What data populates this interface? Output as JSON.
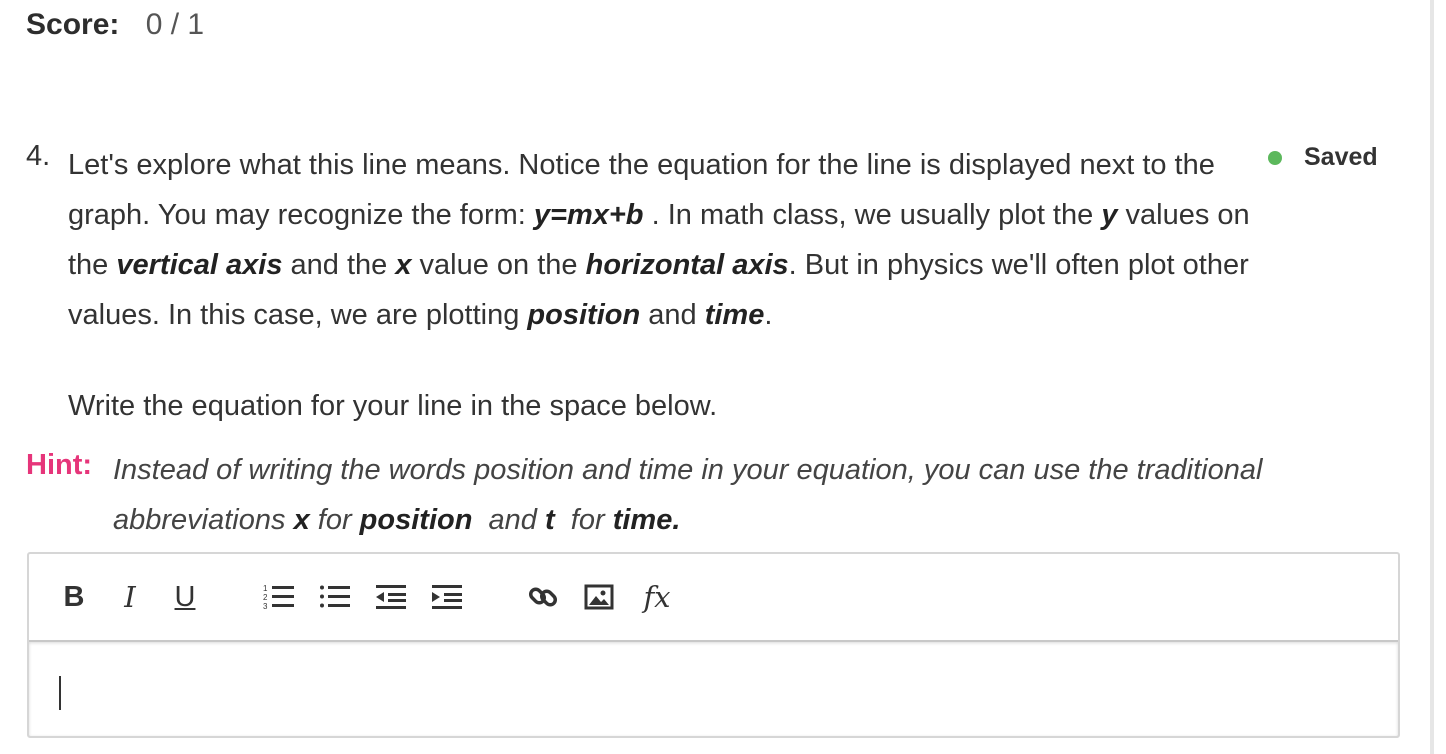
{
  "score": {
    "label": "Score:",
    "value": "0 / 1"
  },
  "question": {
    "number": "4.",
    "para": {
      "t1": "Let's explore what this line means. Notice the equation for the line is displayed next to the graph. You may recognize the form: ",
      "b1": "y=mx+b",
      "t2": " . In math class, we usually plot the ",
      "b2": "y",
      "t3": " values on the ",
      "b3": "vertical axis",
      "t4": " and the ",
      "b4": "x",
      "t5": " value on the ",
      "b5": "horizontal axis",
      "t6": ". But in physics we'll often plot other values. In this case, we are plotting ",
      "b6": "position",
      "t7": " and ",
      "b7": "time",
      "t8": "."
    },
    "write_prompt": "Write the equation for your line in the space below."
  },
  "status": {
    "saved_label": "Saved",
    "dot_color": "#5cb85c"
  },
  "hint": {
    "label": "Hint:",
    "color": "#e6357a",
    "t1": "Instead of writing the words position and time in your equation, you can use the traditional abbreviations ",
    "b1": "x",
    "t2": " for ",
    "b2": "position",
    "t3": "  and ",
    "b3": "t",
    "t4": "  for ",
    "b4": "time."
  },
  "editor": {
    "toolbar": {
      "bold": "B",
      "italic": "I",
      "underline": "U",
      "formula": "fx",
      "icons": [
        "ordered-list-icon",
        "unordered-list-icon",
        "outdent-icon",
        "indent-icon",
        "link-icon",
        "image-icon"
      ]
    },
    "value": ""
  }
}
